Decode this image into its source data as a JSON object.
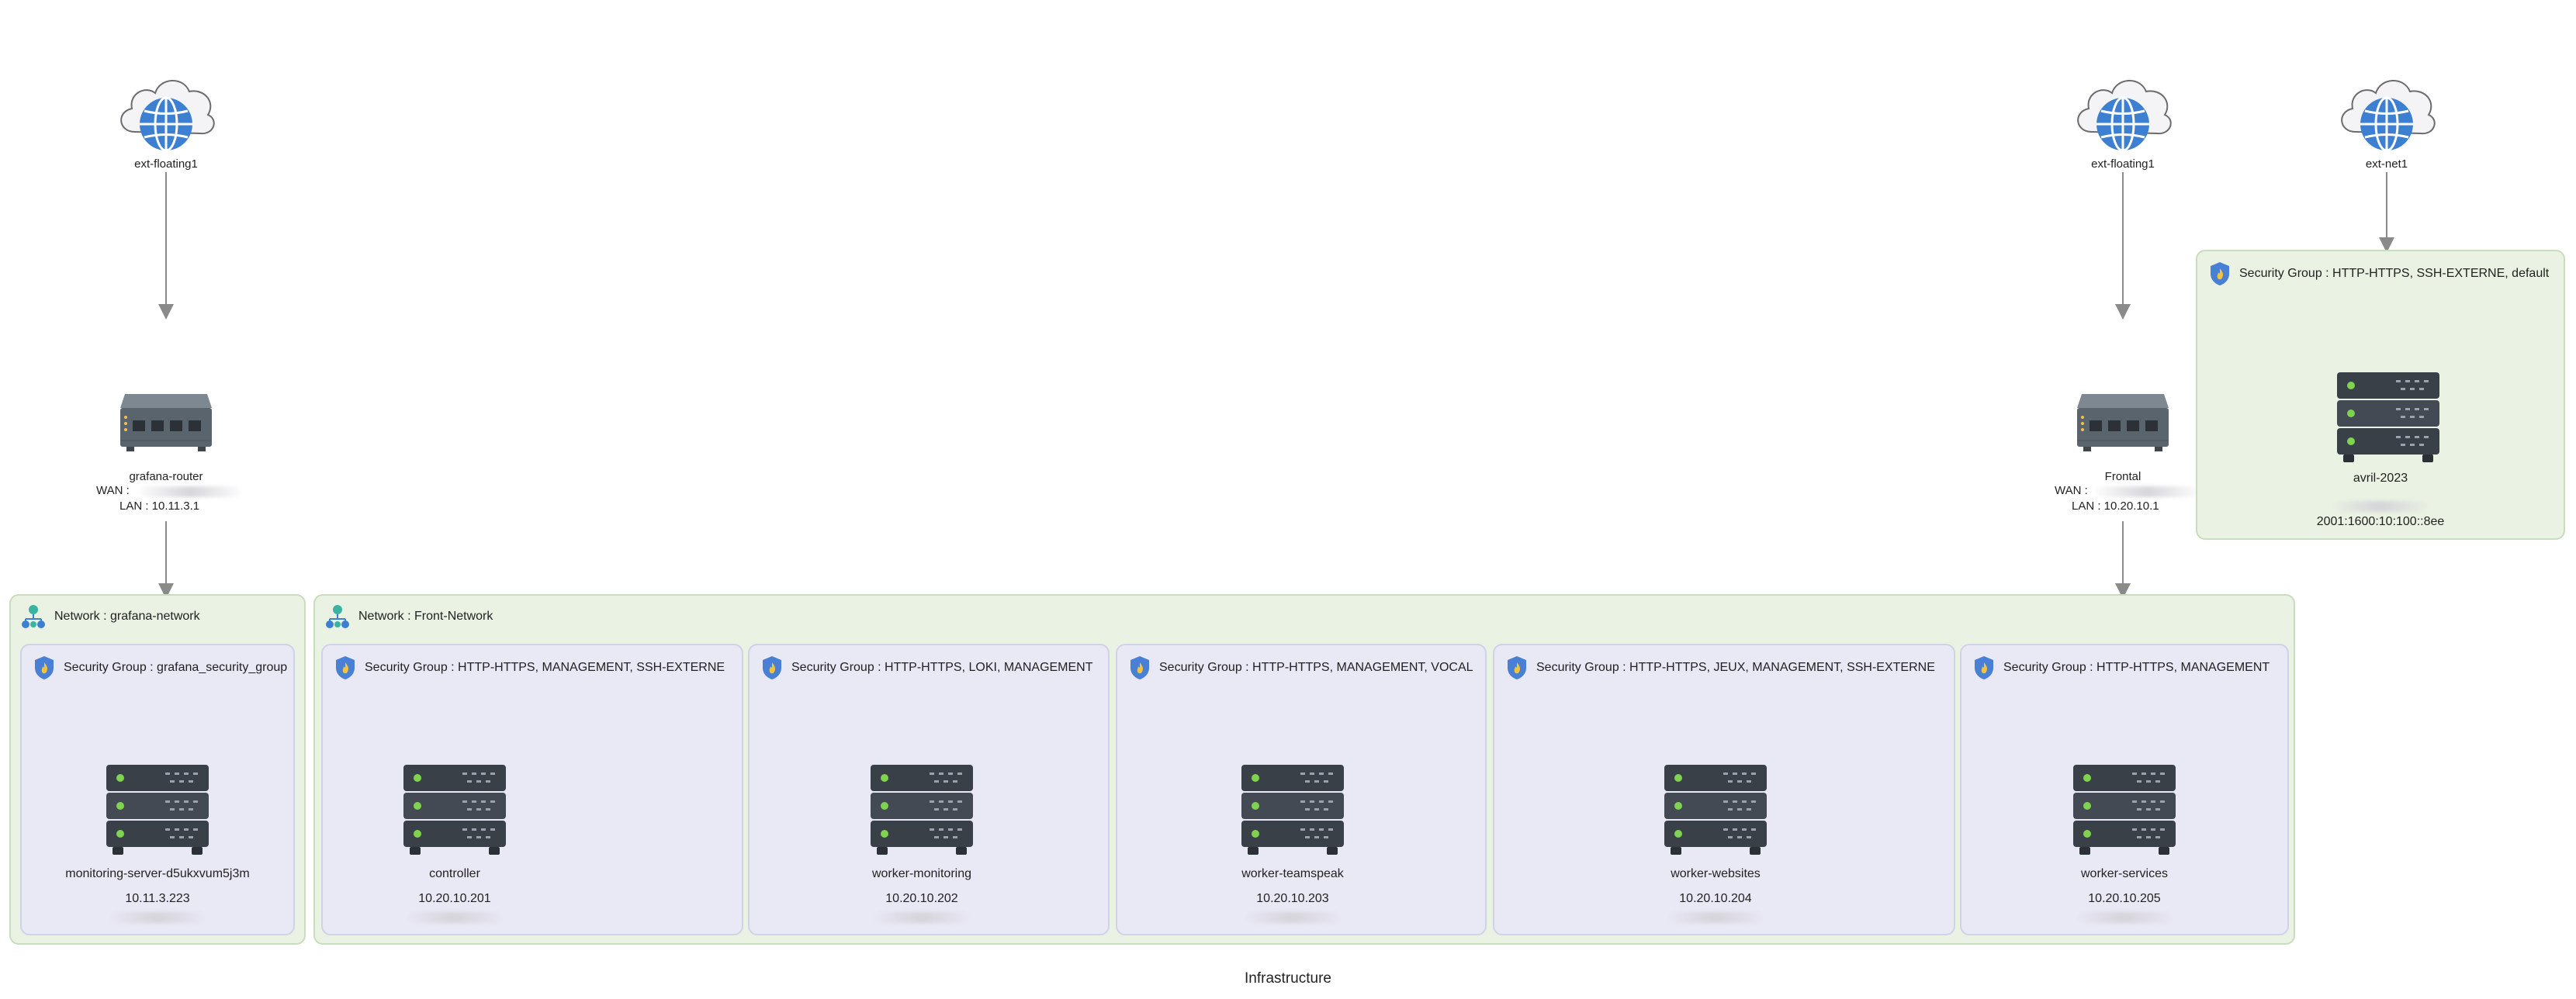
{
  "caption": "Infrastructure",
  "externals": [
    {
      "id": "ext1",
      "label": "ext-floating1"
    },
    {
      "id": "ext2",
      "label": "ext-floating1"
    },
    {
      "id": "ext3",
      "label": "ext-net1"
    }
  ],
  "routers": [
    {
      "id": "r1",
      "name": "grafana-router",
      "wan": "WAN :",
      "lan": "LAN : 10.11.3.1"
    },
    {
      "id": "r2",
      "name": "Frontal",
      "wan": "WAN :",
      "lan": "LAN : 10.20.10.1"
    }
  ],
  "networks": [
    {
      "id": "n1",
      "label": "Network : grafana-network"
    },
    {
      "id": "n2",
      "label": "Network : Front-Network"
    }
  ],
  "security_groups": [
    {
      "id": "sg0",
      "label": "Security Group : HTTP-HTTPS, SSH-EXTERNE, default",
      "server": "avril-2023",
      "ip": "2001:1600:10:100::8ee"
    },
    {
      "id": "sg1",
      "label": "Security Group : grafana_security_group",
      "server": "monitoring-server-d5ukxvum5j3m",
      "ip": "10.11.3.223"
    },
    {
      "id": "sg2",
      "label": "Security Group : HTTP-HTTPS, MANAGEMENT, SSH-EXTERNE",
      "server": "controller",
      "ip": "10.20.10.201"
    },
    {
      "id": "sg3",
      "label": "Security Group : HTTP-HTTPS, LOKI, MANAGEMENT",
      "server": "worker-monitoring",
      "ip": "10.20.10.202"
    },
    {
      "id": "sg4",
      "label": "Security Group : HTTP-HTTPS, MANAGEMENT, VOCAL",
      "server": "worker-teamspeak",
      "ip": "10.20.10.203"
    },
    {
      "id": "sg5",
      "label": "Security Group : HTTP-HTTPS, JEUX, MANAGEMENT, SSH-EXTERNE",
      "server": "worker-websites",
      "ip": "10.20.10.204"
    },
    {
      "id": "sg6",
      "label": "Security Group : HTTP-HTTPS, MANAGEMENT",
      "server": "worker-services",
      "ip": "10.20.10.205"
    }
  ],
  "colors": {
    "network_fill": "#eaf2e3",
    "network_border": "#c9dcbd",
    "sg_fill": "#e9e8f5",
    "sg_border": "#d2d2e6",
    "link": "#8a8a8a",
    "globe": "#3d7fd0",
    "server_body": "#3a4048",
    "server_led": "#7ed34f",
    "shield": "#4a7fd6",
    "shield_flame": "#f4c23c"
  },
  "icons": {
    "external": "cloud-globe-icon",
    "router": "router-icon",
    "server": "server-icon",
    "network": "network-icon",
    "security_group": "shield-icon"
  }
}
